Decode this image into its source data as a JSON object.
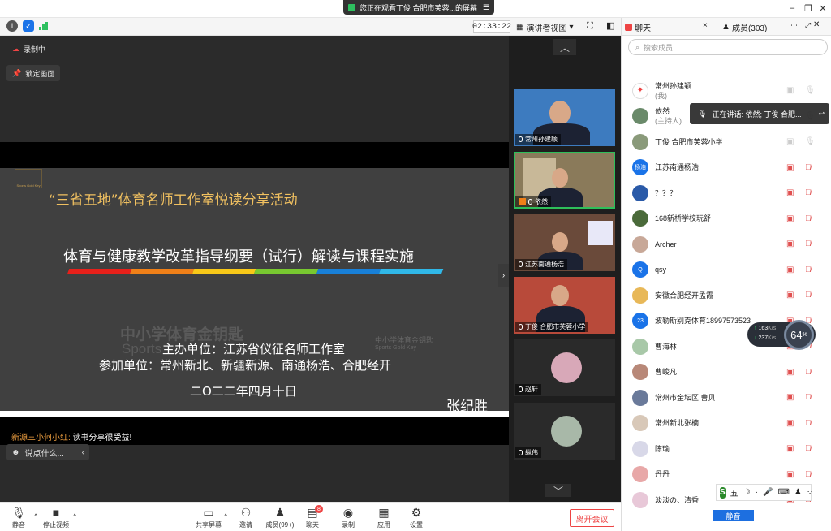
{
  "titlebar": {
    "watching": "您正在观看丁俊  合肥市芙蓉...的屏幕"
  },
  "toolbar": {
    "timer": "02:33:22",
    "view_mode": "演讲者视图"
  },
  "share": {
    "recording": "录制中",
    "lock_label": "锁定画面",
    "slide": {
      "title": "“三省五地”体育名师工作室悦读分享活动",
      "subtitle": "体育与健康教学改革指导纲要（试行）解读与课程实施",
      "host": "主办单位：江苏省仪征名师工作室",
      "participants": "参加单位：常州新北、新疆新源、南通杨浩、合肥经开",
      "date": "二O二二年四月十日",
      "signer": "张纪胜",
      "watermark_cn": "中小学体育金钥匙",
      "watermark_en": "Sports",
      "logo_cn": "中小学体育金钥匙",
      "logo_en": "Sports Gold Key",
      "rainbow": [
        "#e8201a",
        "#f08018",
        "#f8c818",
        "#78c830",
        "#1880d8",
        "#30b8e8"
      ]
    },
    "chat": {
      "sender": "新源三小何小红:",
      "message": "读书分享很受益!",
      "input_placeholder": "说点什么..."
    }
  },
  "videos": [
    {
      "name": "常州孙建颖",
      "style": "person-blue"
    },
    {
      "name": "依然",
      "style": "person-room"
    },
    {
      "name": "江苏南通杨浩",
      "style": "person-shelf"
    },
    {
      "name": "丁俊  合肥市芙蓉小学",
      "style": "person-red"
    },
    {
      "name": "赵轩",
      "style": "avatar"
    },
    {
      "name": "纵伟",
      "style": "avatar"
    }
  ],
  "bottombar": {
    "items": [
      {
        "label": "静音",
        "icon": "mic-icon"
      },
      {
        "label": "停止视频",
        "icon": "camera-icon"
      },
      {
        "label": "共享屏幕",
        "icon": "screen-share-icon"
      },
      {
        "label": "邀请",
        "icon": "invite-icon"
      },
      {
        "label": "成员(99+)",
        "icon": "members-icon"
      },
      {
        "label": "聊天",
        "icon": "chat-icon",
        "badge": "8"
      },
      {
        "label": "录制",
        "icon": "record-icon"
      },
      {
        "label": "应用",
        "icon": "apps-icon"
      },
      {
        "label": "设置",
        "icon": "settings-icon"
      }
    ],
    "leave": "离开会议"
  },
  "panel": {
    "chat_tab": "聊天",
    "members_tab": "成员(303)",
    "search_placeholder": "搜索成员",
    "mute_all": "静音",
    "speaking": "正在讲话: 依然; 丁俊  合肥...",
    "members": [
      {
        "name": "常州孙建颖",
        "role": "(我)",
        "avatar": "logo",
        "color": "#ffffff",
        "mic": "on"
      },
      {
        "name": "依然",
        "role": "(主持人)",
        "avatar": "photo",
        "color": "#6a8a6a",
        "mic": "on"
      },
      {
        "name": "丁俊  合肥市芙蓉小学",
        "role": "",
        "avatar": "photo",
        "color": "#8a9a7a",
        "mic": "on"
      },
      {
        "name": "江苏南通杨浩",
        "role": "",
        "avatar": "杨浩",
        "color": "#1a73e8",
        "mic": "off"
      },
      {
        "name": "？？？",
        "role": "",
        "avatar": "photo",
        "color": "#2a5aa8",
        "mic": "off"
      },
      {
        "name": "168新桥学校玩舒",
        "role": "",
        "avatar": "photo",
        "color": "#4a6a3a",
        "mic": "off"
      },
      {
        "name": "Archer",
        "role": "",
        "avatar": "photo",
        "color": "#c8a898",
        "mic": "off"
      },
      {
        "name": "qsy",
        "role": "",
        "avatar": "Q",
        "color": "#1a73e8",
        "mic": "off"
      },
      {
        "name": "安徽合肥经开孟霞",
        "role": "",
        "avatar": "photo",
        "color": "#e8b858",
        "mic": "off"
      },
      {
        "name": "波勒斯别克体育18997573523",
        "role": "",
        "avatar": "23",
        "color": "#1a73e8",
        "mic": "off"
      },
      {
        "name": "曹海林",
        "role": "",
        "avatar": "photo",
        "color": "#a8c8a8",
        "mic": "off"
      },
      {
        "name": "曹峻凡",
        "role": "",
        "avatar": "photo",
        "color": "#b88878",
        "mic": "off"
      },
      {
        "name": "常州市金坛区 曹贝",
        "role": "",
        "avatar": "photo",
        "color": "#6a7a9a",
        "mic": "off"
      },
      {
        "name": "常州新北张楠",
        "role": "",
        "avatar": "photo",
        "color": "#d8c8b8",
        "mic": "off"
      },
      {
        "name": "陈瑜",
        "role": "",
        "avatar": "photo",
        "color": "#d8d8e8",
        "mic": "off"
      },
      {
        "name": "丹丹",
        "role": "",
        "avatar": "photo",
        "color": "#e8a8a8",
        "mic": "off"
      },
      {
        "name": "淡淡の、清香",
        "role": "",
        "avatar": "photo",
        "color": "#e8c8d8",
        "mic": "off"
      }
    ]
  },
  "network": {
    "up": "163",
    "down": "237",
    "unit": "K/s",
    "cpu": "64",
    "cpu_unit": "%"
  },
  "ime": {
    "label": "五"
  }
}
